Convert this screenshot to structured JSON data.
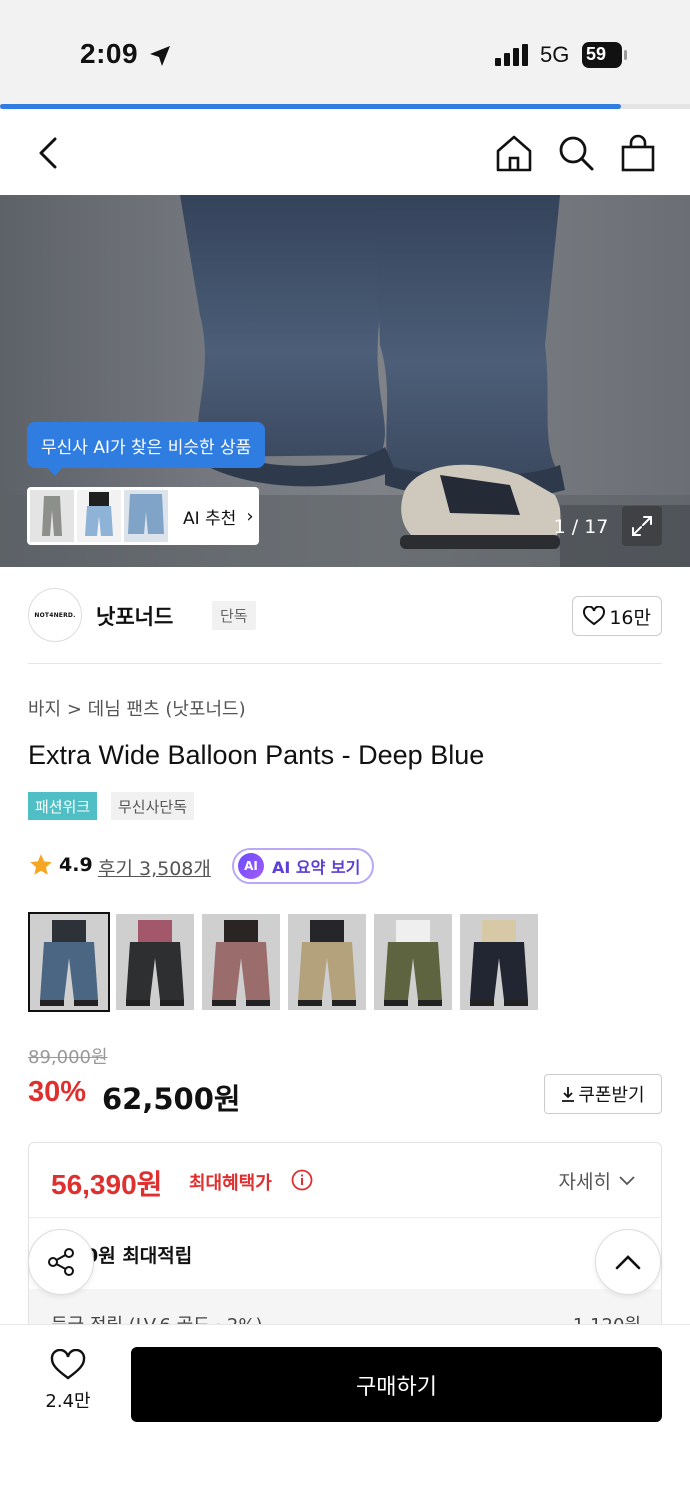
{
  "status_bar": {
    "time": "2:09",
    "network": "5G",
    "battery": "59"
  },
  "load_progress": 0.9,
  "hero": {
    "ai_bubble": "무신사 AI가 찾은 비슷한 상품",
    "ai_card_label": "AI 추천",
    "page_counter": "1 / 17"
  },
  "brand": {
    "logo_text": "NOT4NERD.",
    "name": "낫포너드",
    "tag": "단독",
    "likes": "16만"
  },
  "product": {
    "breadcrumb": "바지 > 데님 팬츠 (낫포너드)",
    "title": "Extra Wide Balloon Pants - Deep Blue",
    "badges": [
      "패션위크",
      "무신사단독"
    ],
    "rating": "4.9",
    "reviews": "후기 3,508개",
    "ai_summary": "AI 요약 보기",
    "ai_summary_icon": "AI",
    "colors": [
      {
        "name": "deep-blue",
        "top": "#2d3138",
        "bottom": "#4b6683"
      },
      {
        "name": "black-washed",
        "top": "#a3576a",
        "bottom": "#2e2f31"
      },
      {
        "name": "pink",
        "top": "#2b2424",
        "bottom": "#9a6c6c"
      },
      {
        "name": "beige",
        "top": "#26262a",
        "bottom": "#b3a27c"
      },
      {
        "name": "khaki",
        "top": "#efefef",
        "bottom": "#5e6440"
      },
      {
        "name": "navy",
        "top": "#d8c9a6",
        "bottom": "#222632"
      }
    ]
  },
  "price": {
    "original": "89,000원",
    "discount": "30%",
    "sale": "62,500원",
    "coupon": "쿠폰받기"
  },
  "benefit": {
    "max_price": "56,390원",
    "max_label": "최대혜택가",
    "detail": "자세히",
    "points": "0원 최대적립",
    "grade_label": "등급 적립 (LV.6 골드 · 2%)",
    "grade_value": "1,120원"
  },
  "bottom": {
    "wish_count": "2.4만",
    "buy": "구매하기"
  },
  "colors": {
    "accent_blue": "#2f7de1",
    "sale_red": "#e02f2f",
    "badge_teal": "#4fbfc5",
    "ai_purple": "#5a3fd8"
  }
}
